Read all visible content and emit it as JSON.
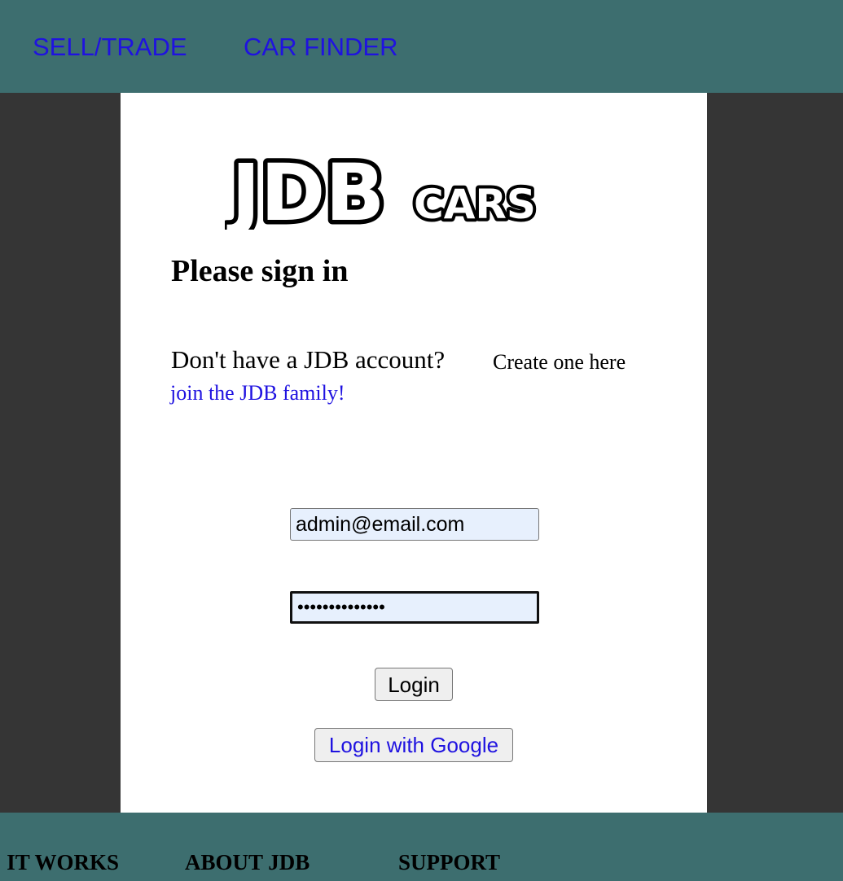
{
  "nav": {
    "sell_trade": "SELL/TRADE",
    "car_finder": "CAR FINDER"
  },
  "logo": {
    "main": "JDB",
    "sub": "CARS"
  },
  "signin": {
    "heading": "Please sign in",
    "no_account": "Don't have a JDB account?",
    "create_one": "Create one here",
    "join_link": "join the JDB family!",
    "email_value": "admin@email.com",
    "password_value": "••••••••••••••",
    "login_label": "Login",
    "google_label": "Login with Google"
  },
  "footer": {
    "how_it_works": "IT WORKS",
    "about": "ABOUT JDB",
    "support": "SUPPORT"
  },
  "colors": {
    "header_bg": "#3d6e6f",
    "page_bg": "#353535",
    "link": "#1f12e0",
    "input_bg": "#e7f0fd"
  }
}
